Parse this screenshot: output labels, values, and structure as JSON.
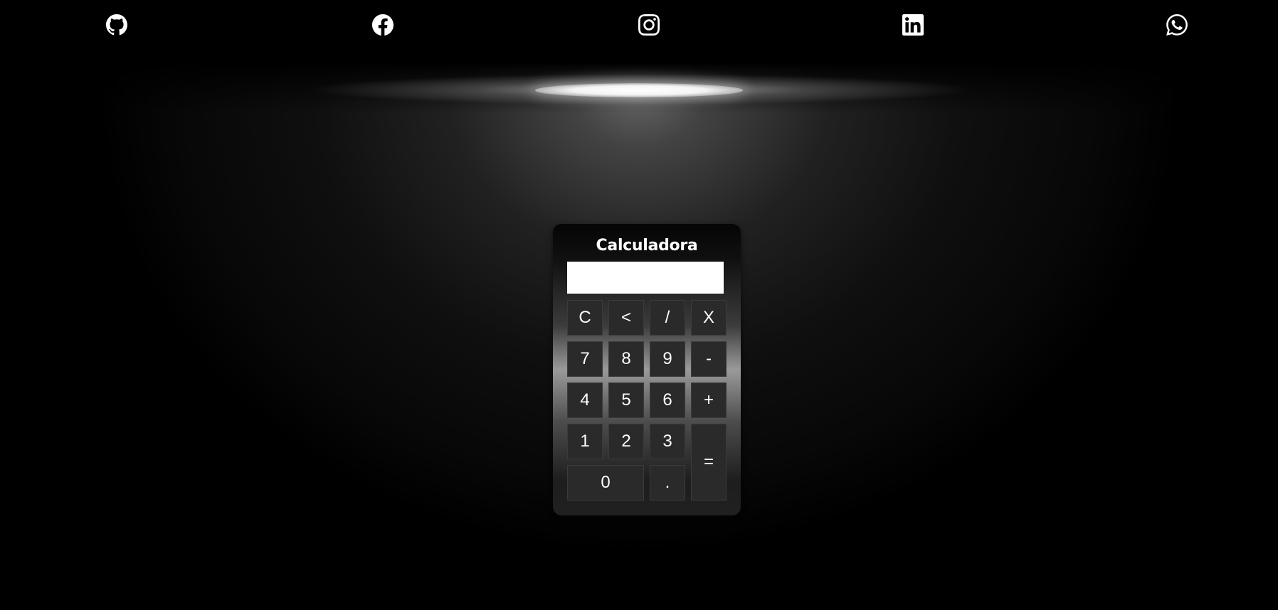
{
  "calculator": {
    "title": "Calculadora",
    "display_value": "",
    "keys": {
      "clear": "C",
      "backspace": "<",
      "divide": "/",
      "multiply": "X",
      "seven": "7",
      "eight": "8",
      "nine": "9",
      "minus": "-",
      "four": "4",
      "five": "5",
      "six": "6",
      "plus": "+",
      "one": "1",
      "two": "2",
      "three": "3",
      "equals": "=",
      "zero": "0",
      "decimal": "."
    }
  },
  "social_links": [
    {
      "name": "github",
      "icon": "github-icon"
    },
    {
      "name": "facebook",
      "icon": "facebook-icon"
    },
    {
      "name": "instagram",
      "icon": "instagram-icon"
    },
    {
      "name": "linkedin",
      "icon": "linkedin-icon"
    },
    {
      "name": "whatsapp",
      "icon": "whatsapp-icon"
    }
  ],
  "colors": {
    "background": "#000000",
    "key_background": "#2a2a2a",
    "key_text": "#ffffff",
    "display_background": "#ffffff",
    "lamp_light": "#ffffff"
  }
}
